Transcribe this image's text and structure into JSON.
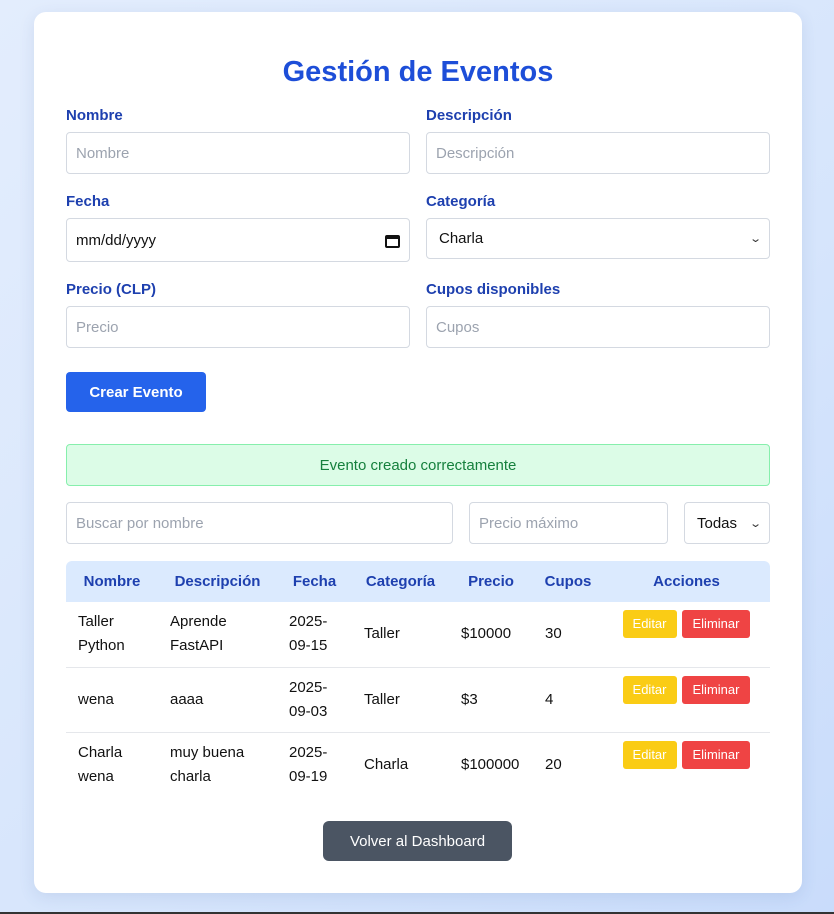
{
  "page": {
    "title": "Gestión de Eventos"
  },
  "form": {
    "nombre": {
      "label": "Nombre",
      "placeholder": "Nombre"
    },
    "descripcion": {
      "label": "Descripción",
      "placeholder": "Descripción"
    },
    "fecha": {
      "label": "Fecha",
      "value": "mm/dd/yyyy",
      "icon": "calendar-icon"
    },
    "categoria": {
      "label": "Categoría",
      "selected": "Charla",
      "icon": "chevron-down-icon"
    },
    "precio": {
      "label": "Precio (CLP)",
      "placeholder": "Precio"
    },
    "cupos": {
      "label": "Cupos disponibles",
      "placeholder": "Cupos"
    },
    "submit_label": "Crear Evento"
  },
  "alert": {
    "message": "Evento creado correctamente",
    "color": "#15803d"
  },
  "filters": {
    "search_placeholder": "Buscar por nombre",
    "max_price_placeholder": "Precio máximo",
    "category_selected": "Todas"
  },
  "table": {
    "headers": [
      "Nombre",
      "Descripción",
      "Fecha",
      "Categoría",
      "Precio",
      "Cupos",
      "Acciones"
    ],
    "edit_label": "Editar",
    "delete_label": "Eliminar",
    "rows": [
      {
        "nombre": "Taller Python",
        "descripcion": "Aprende FastAPI",
        "fecha": "2025-09-15",
        "categoria": "Taller",
        "precio": "$10000",
        "cupos": "30"
      },
      {
        "nombre": "wena",
        "descripcion": "aaaa",
        "fecha": "2025-09-03",
        "categoria": "Taller",
        "precio": "$3",
        "cupos": "4"
      },
      {
        "nombre": "Charla wena",
        "descripcion": "muy buena charla",
        "fecha": "2025-09-19",
        "categoria": "Charla",
        "precio": "$100000",
        "cupos": "20"
      }
    ]
  },
  "back_button_label": "Volver al Dashboard",
  "colors": {
    "primary": "#2563eb",
    "heading": "#1d4ed8",
    "edit": "#facc15",
    "delete": "#ef4444",
    "back": "#4b5563"
  }
}
